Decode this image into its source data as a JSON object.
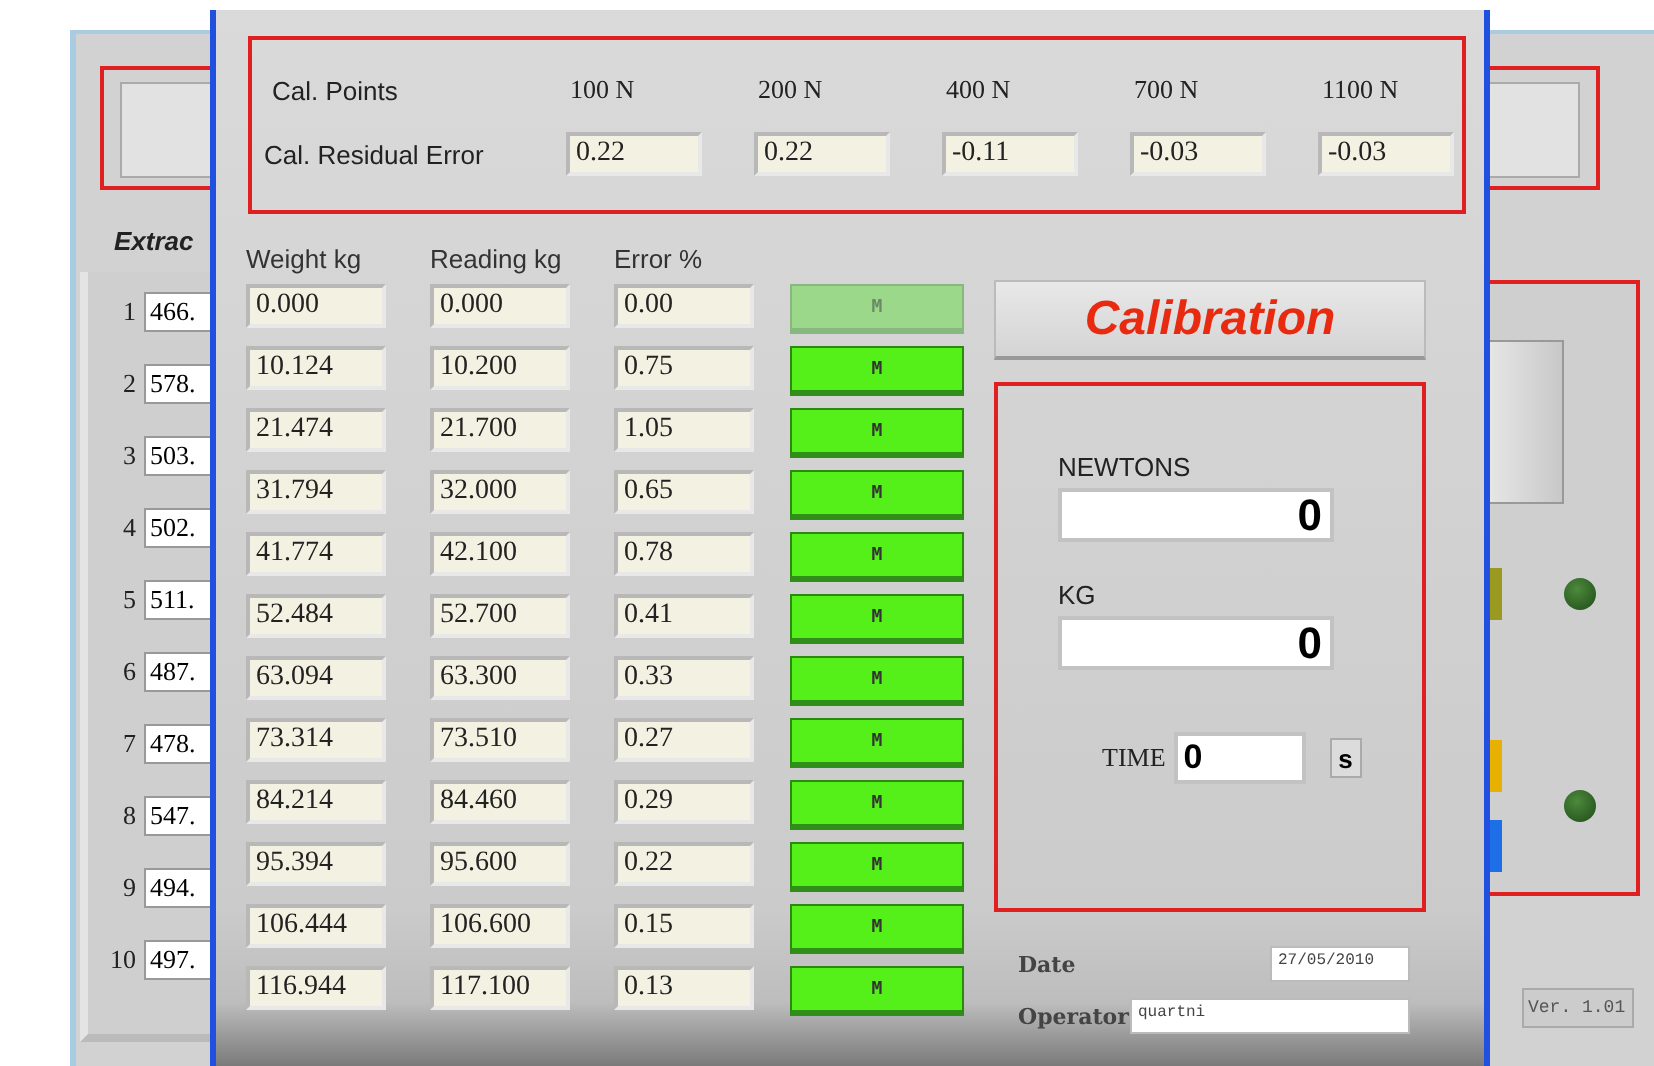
{
  "background": {
    "section_title": "Extrac",
    "entries": [
      {
        "index": "1",
        "value": "466."
      },
      {
        "index": "2",
        "value": "578."
      },
      {
        "index": "3",
        "value": "503."
      },
      {
        "index": "4",
        "value": "502."
      },
      {
        "index": "5",
        "value": "511."
      },
      {
        "index": "6",
        "value": "487."
      },
      {
        "index": "7",
        "value": "478."
      },
      {
        "index": "8",
        "value": "547."
      },
      {
        "index": "9",
        "value": "494."
      },
      {
        "index": "10",
        "value": "497."
      }
    ],
    "leds": [
      {
        "on": false
      },
      {
        "on": false
      }
    ],
    "version": "Ver. 1.01"
  },
  "dialog": {
    "cal_points": {
      "label": "Cal. Points",
      "points": [
        "100 N",
        "200 N",
        "400 N",
        "700 N",
        "1100 N"
      ]
    },
    "residual_error": {
      "label": "Cal. Residual Error",
      "values": [
        "0.22",
        "0.22",
        "-0.11",
        "-0.03",
        "-0.03"
      ]
    },
    "columns": [
      "Weight kg",
      "Reading kg",
      "Error %"
    ],
    "rows": [
      {
        "weight": "0.000",
        "reading": "0.000",
        "error": "0.00",
        "button": "M",
        "enabled": false
      },
      {
        "weight": "10.124",
        "reading": "10.200",
        "error": "0.75",
        "button": "M",
        "enabled": true
      },
      {
        "weight": "21.474",
        "reading": "21.700",
        "error": "1.05",
        "button": "M",
        "enabled": true
      },
      {
        "weight": "31.794",
        "reading": "32.000",
        "error": "0.65",
        "button": "M",
        "enabled": true
      },
      {
        "weight": "41.774",
        "reading": "42.100",
        "error": "0.78",
        "button": "M",
        "enabled": true
      },
      {
        "weight": "52.484",
        "reading": "52.700",
        "error": "0.41",
        "button": "M",
        "enabled": true
      },
      {
        "weight": "63.094",
        "reading": "63.300",
        "error": "0.33",
        "button": "M",
        "enabled": true
      },
      {
        "weight": "73.314",
        "reading": "73.510",
        "error": "0.27",
        "button": "M",
        "enabled": true
      },
      {
        "weight": "84.214",
        "reading": "84.460",
        "error": "0.29",
        "button": "M",
        "enabled": true
      },
      {
        "weight": "95.394",
        "reading": "95.600",
        "error": "0.22",
        "button": "M",
        "enabled": true
      },
      {
        "weight": "106.444",
        "reading": "106.600",
        "error": "0.15",
        "button": "M",
        "enabled": true
      },
      {
        "weight": "116.944",
        "reading": "117.100",
        "error": "0.13",
        "button": "M",
        "enabled": true
      }
    ],
    "title_button": "Calibration",
    "newtons": {
      "label": "NEWTONS",
      "value": "0"
    },
    "kg": {
      "label": "KG",
      "value": "0"
    },
    "time": {
      "label": "TIME",
      "value": "0",
      "unit": "s"
    },
    "date": {
      "label": "Date",
      "value": "27/05/2010"
    },
    "operator": {
      "label": "Operator",
      "value": "quartni"
    }
  }
}
